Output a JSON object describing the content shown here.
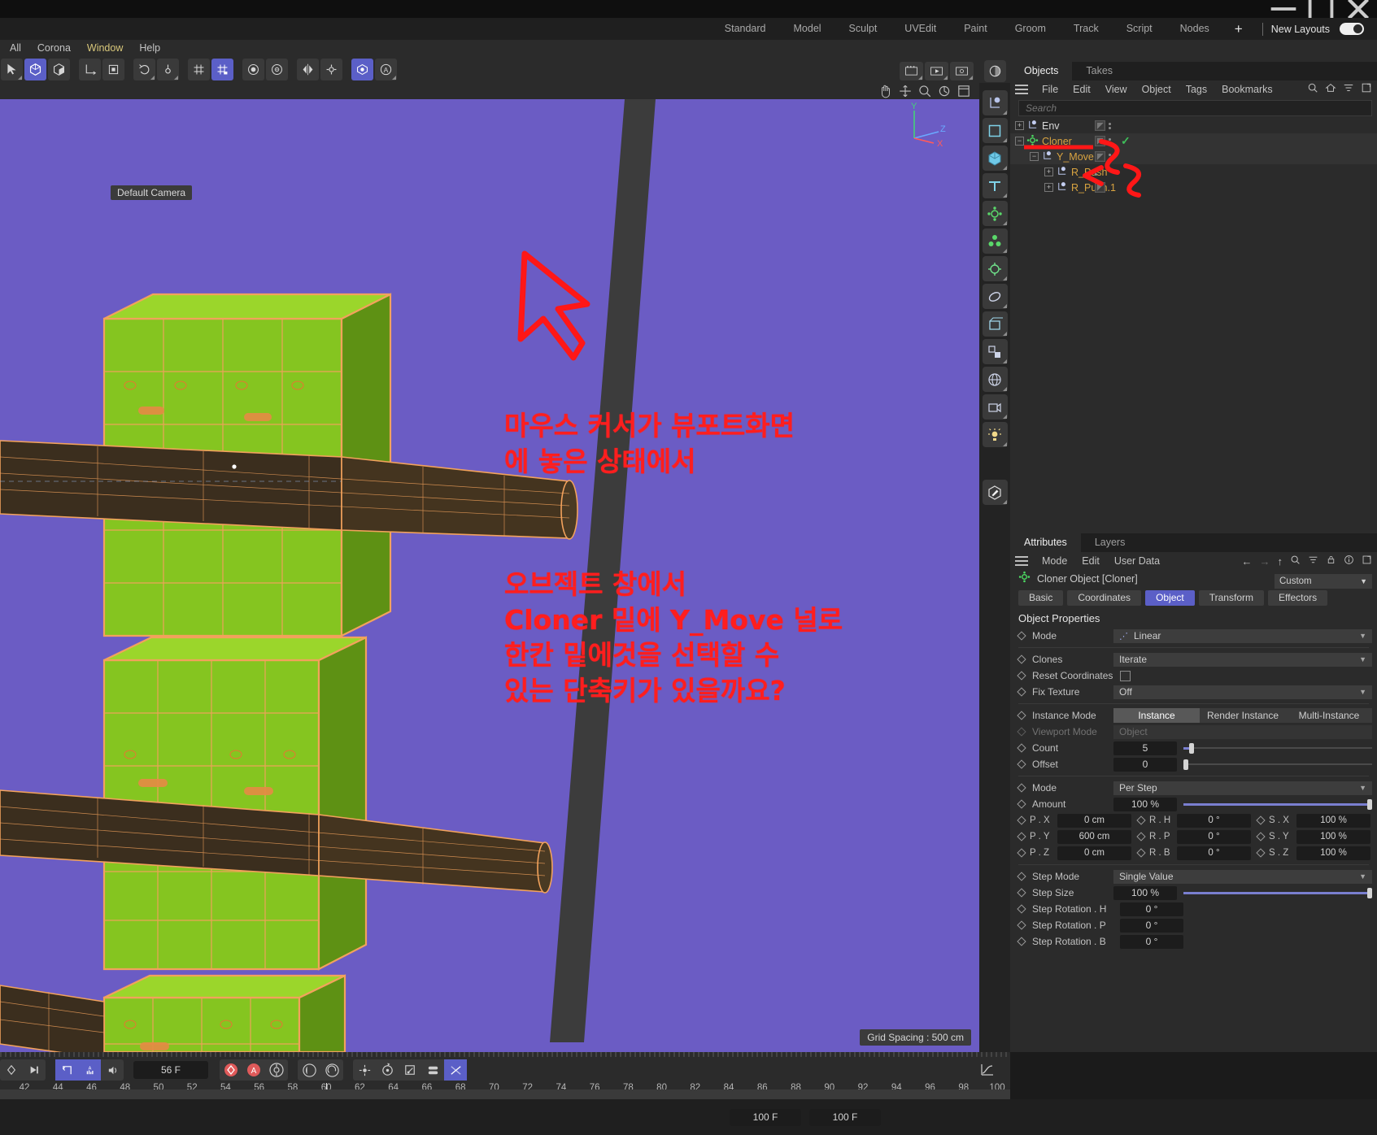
{
  "window": {
    "minimize": "—",
    "maximize": "▢",
    "close": "✕"
  },
  "layout_bar": {
    "tabs": [
      "Standard",
      "Model",
      "Sculpt",
      "UVEdit",
      "Paint",
      "Groom",
      "Track",
      "Script",
      "Nodes"
    ],
    "plus": "+",
    "new_layouts_label": "New Layouts"
  },
  "menu": {
    "items": [
      "All",
      "Corona",
      "Window",
      "Help"
    ],
    "active": "Window"
  },
  "viewport": {
    "camera_label": "Default Camera",
    "grid_label": "Grid Spacing : 500 cm",
    "axis": {
      "x": "X",
      "y": "Y",
      "z": "Z"
    },
    "annotations": [
      "마우스 커서가 뷰포트화면\n에 놓은 상태에서",
      "오브젝트 창에서\nCloner 밑에 Y_Move 널로\n한칸 밑에것을 선택할 수\n있는 단축키가 있을까요?"
    ],
    "annotation_color": "#ff1e1e"
  },
  "object_manager": {
    "tabs": [
      "Objects",
      "Takes"
    ],
    "active_tab": "Objects",
    "menu": [
      "File",
      "Edit",
      "View",
      "Object",
      "Tags",
      "Bookmarks"
    ],
    "search_placeholder": "Search",
    "search_value": "",
    "tree": [
      {
        "name": "Env",
        "indent": 0,
        "expander": "+",
        "icon": "null-object-icon",
        "color": "white",
        "selected": false,
        "tag": true,
        "check": false
      },
      {
        "name": "Cloner",
        "indent": 0,
        "expander": "−",
        "icon": "cloner-icon",
        "color": "orange",
        "selected": true,
        "tag": true,
        "check": true
      },
      {
        "name": "Y_Move",
        "indent": 1,
        "expander": "−",
        "icon": "null-object-icon",
        "color": "orange",
        "selected": true,
        "tag": true,
        "check": false
      },
      {
        "name": "R_Push",
        "indent": 2,
        "expander": "+",
        "icon": "null-object-icon",
        "color": "orange",
        "selected": false,
        "tag": false,
        "check": false
      },
      {
        "name": "R_Push.1",
        "indent": 2,
        "expander": "+",
        "icon": "null-object-icon",
        "color": "orange",
        "selected": false,
        "tag": true,
        "check": false
      }
    ]
  },
  "attribute_manager": {
    "tabs": [
      "Attributes",
      "Layers"
    ],
    "active_tab": "Attributes",
    "menu": [
      "Mode",
      "Edit",
      "User Data"
    ],
    "object_title": "Cloner Object [Cloner]",
    "preset_dropdown": "Custom",
    "tabs_row": [
      "Basic",
      "Coordinates",
      "Object",
      "Transform",
      "Effectors"
    ],
    "active_section_tab": "Object",
    "section_title": "Object Properties",
    "fields": {
      "mode": {
        "label": "Mode",
        "value": "Linear"
      },
      "clones": {
        "label": "Clones",
        "value": "Iterate"
      },
      "reset_coordinates": {
        "label": "Reset Coordinates",
        "checked": false
      },
      "fix_texture": {
        "label": "Fix Texture",
        "value": "Off"
      },
      "instance_mode": {
        "label": "Instance Mode",
        "options": [
          "Instance",
          "Render Instance",
          "Multi-Instance"
        ],
        "selected": "Instance"
      },
      "viewport_mode": {
        "label": "Viewport Mode",
        "value": "Object",
        "disabled": true
      },
      "count": {
        "label": "Count",
        "value": "5",
        "slider_pct": 4
      },
      "offset": {
        "label": "Offset",
        "value": "0",
        "slider_pct": 0
      },
      "mode2": {
        "label": "Mode",
        "value": "Per Step"
      },
      "amount": {
        "label": "Amount",
        "value": "100 %",
        "slider_pct": 100
      },
      "px": {
        "label": "P . X",
        "value": "0 cm"
      },
      "py": {
        "label": "P . Y",
        "value": "600 cm"
      },
      "pz": {
        "label": "P . Z",
        "value": "0 cm"
      },
      "rh": {
        "label": "R . H",
        "value": "0 °"
      },
      "rp": {
        "label": "R . P",
        "value": "0 °"
      },
      "rb": {
        "label": "R . B",
        "value": "0 °"
      },
      "sx": {
        "label": "S . X",
        "value": "100 %"
      },
      "sy": {
        "label": "S . Y",
        "value": "100 %"
      },
      "sz": {
        "label": "S . Z",
        "value": "100 %"
      },
      "step_mode": {
        "label": "Step Mode",
        "value": "Single Value"
      },
      "step_size": {
        "label": "Step Size",
        "value": "100 %",
        "slider_pct": 100
      },
      "step_rot_h": {
        "label": "Step Rotation . H",
        "value": "0 °"
      },
      "step_rot_p": {
        "label": "Step Rotation . P",
        "value": "0 °"
      },
      "step_rot_b": {
        "label": "Step Rotation . B",
        "value": "0 °"
      }
    }
  },
  "timeline": {
    "current_frame": "56 F",
    "ruler_start": 42,
    "ruler_end": 100,
    "ruler_labels": [
      42,
      44,
      46,
      48,
      50,
      52,
      54,
      56,
      58,
      60,
      62,
      64,
      66,
      68,
      70,
      72,
      74,
      76,
      78,
      80,
      82,
      84,
      86,
      88,
      90,
      92,
      94,
      96,
      98,
      100
    ],
    "playhead_frame": 60
  },
  "status_bar": {
    "field_left": "100 F",
    "field_right": "100 F"
  }
}
